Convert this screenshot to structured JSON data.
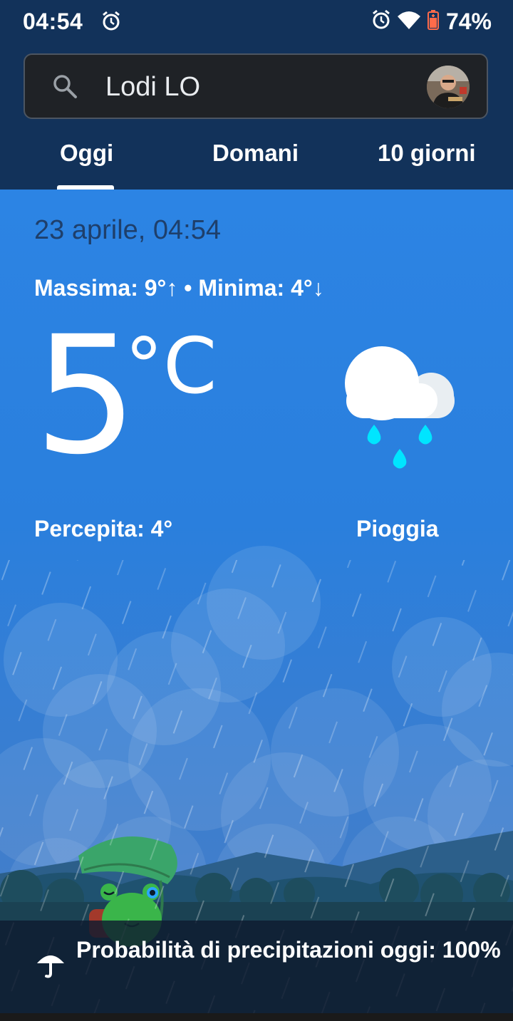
{
  "status_bar": {
    "time": "04:54",
    "battery_text": "74%"
  },
  "search": {
    "location": "Lodi LO"
  },
  "tabs": [
    {
      "label": "Oggi",
      "selected": true
    },
    {
      "label": "Domani",
      "selected": false
    },
    {
      "label": "10 giorni",
      "selected": false
    }
  ],
  "weather": {
    "date_time": "23 aprile, 04:54",
    "max_min": "Massima: 9°↑ • Minima: 4°↓",
    "temperature": "5",
    "unit": "°C",
    "feels_like": "Percepita: 4°",
    "condition": "Pioggia"
  },
  "precipitation": {
    "label": "Probabilità di precipitazioni oggi: 100%"
  },
  "colors": {
    "header_bg": "#12325a",
    "sky_top": "#2c84e4",
    "rain_drop": "#00e5ff"
  },
  "icons": [
    "alarm-icon",
    "wifi-icon",
    "battery-icon",
    "search-icon",
    "rain-cloud-icon",
    "umbrella-icon"
  ]
}
